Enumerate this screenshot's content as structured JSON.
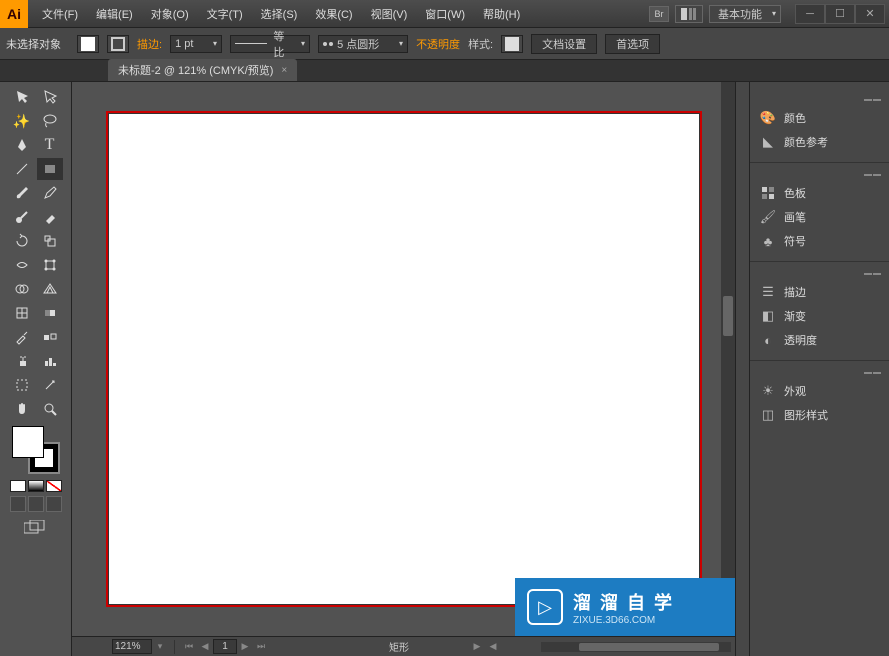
{
  "app": {
    "logo": "Ai"
  },
  "menu": {
    "file": "文件(F)",
    "edit": "编辑(E)",
    "object": "对象(O)",
    "type": "文字(T)",
    "select": "选择(S)",
    "effect": "效果(C)",
    "view": "视图(V)",
    "window": "窗口(W)",
    "help": "帮助(H)"
  },
  "titlebar": {
    "br": "Br",
    "workspace": "基本功能"
  },
  "options": {
    "no_selection": "未选择对象",
    "stroke_label": "描边:",
    "stroke_value": "1 pt",
    "uniform": "等比",
    "brush_value": "5 点圆形",
    "opacity_label": "不透明度",
    "style_label": "样式:",
    "doc_setup": "文档设置",
    "preferences": "首选项"
  },
  "tab": {
    "title": "未标题-2 @ 121% (CMYK/预览)",
    "close": "×"
  },
  "status": {
    "zoom": "121%",
    "page": "1",
    "tool": "矩形"
  },
  "panels": {
    "color": "颜色",
    "color_guide": "颜色参考",
    "swatches": "色板",
    "brushes": "画笔",
    "symbols": "符号",
    "stroke": "描边",
    "gradient": "渐变",
    "transparency": "透明度",
    "appearance": "外观",
    "graphic_styles": "图形样式"
  },
  "watermark": {
    "title": "溜 溜 自 学",
    "sub": "ZIXUE.3D66.COM"
  }
}
